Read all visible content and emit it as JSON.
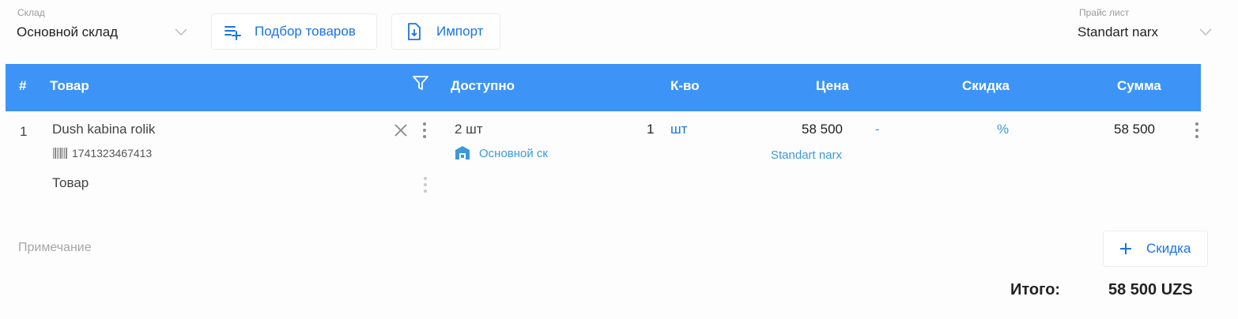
{
  "warehouse": {
    "label": "Склад",
    "value": "Основной склад"
  },
  "toolbar": {
    "pick_label": "Подбор товаров",
    "import_label": "Импорт"
  },
  "price_list": {
    "label": "Прайс лист",
    "value": "Standart narx"
  },
  "table": {
    "headers": {
      "num": "#",
      "product": "Товар",
      "available": "Доступно",
      "qty": "К-во",
      "price": "Цена",
      "discount": "Скидка",
      "sum": "Сумма"
    },
    "rows": [
      {
        "num": "1",
        "name": "Dush kabina rolik",
        "barcode": "1741323467413",
        "type": "Товар",
        "available": "2 шт",
        "available_warehouse": "Основной ск",
        "qty": "1",
        "unit": "шт",
        "price": "58 500",
        "price_list": "Standart narx",
        "discount_value": "-",
        "discount_unit": "%",
        "sum": "58 500"
      }
    ]
  },
  "note": {
    "placeholder": "Примечание"
  },
  "discount_button": {
    "label": "Скидка"
  },
  "total": {
    "label": "Итого:",
    "value": "58 500 UZS"
  },
  "colors": {
    "header_bg": "#3d94f6",
    "accent": "#1a73e8"
  },
  "icons": {
    "pick": "playlist-add-icon",
    "import": "file-import-icon",
    "filter": "filter-icon",
    "barcode": "barcode-icon",
    "warehouse": "warehouse-icon",
    "remove": "close-icon",
    "plus": "plus-icon"
  }
}
